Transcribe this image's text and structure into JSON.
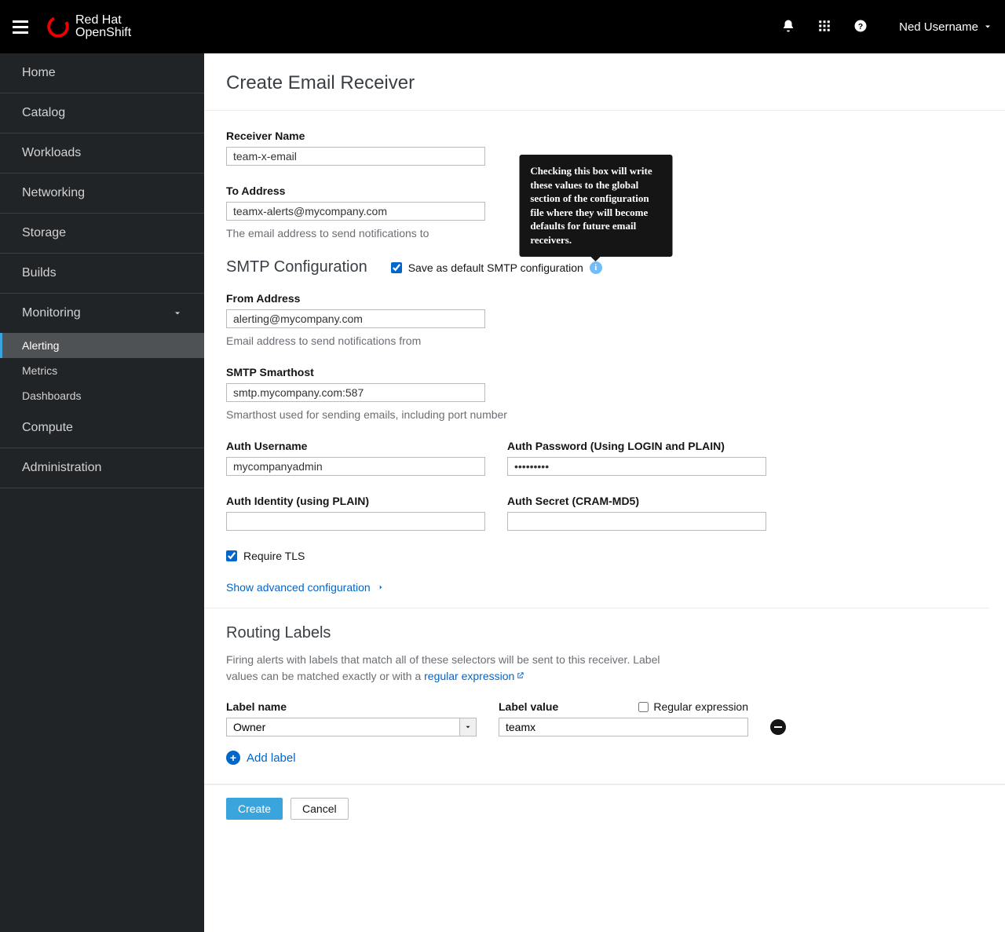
{
  "header": {
    "brand_line1": "Red Hat",
    "brand_line2": "OpenShift",
    "username": "Ned Username"
  },
  "sidebar": {
    "items": [
      {
        "label": "Home"
      },
      {
        "label": "Catalog"
      },
      {
        "label": "Workloads"
      },
      {
        "label": "Networking"
      },
      {
        "label": "Storage"
      },
      {
        "label": "Builds"
      },
      {
        "label": "Monitoring",
        "expanded": true,
        "children": [
          {
            "label": "Alerting",
            "active": true
          },
          {
            "label": "Metrics"
          },
          {
            "label": "Dashboards"
          }
        ]
      },
      {
        "label": "Compute"
      },
      {
        "label": "Administration"
      }
    ]
  },
  "page": {
    "title": "Create Email Receiver",
    "receiver_name_label": "Receiver Name",
    "receiver_name_value": "team-x-email",
    "to_address_label": "To Address",
    "to_address_value": "teamx-alerts@mycompany.com",
    "to_address_help": "The email address to send notifications to",
    "smtp_section_title": "SMTP Configuration",
    "save_default_label": "Save as default SMTP configuration",
    "save_default_checked": true,
    "tooltip_text": "Checking this box will write these values to the global section of the configuration file where they will become defaults for future email receivers.",
    "from_address_label": "From Address",
    "from_address_value": "alerting@mycompany.com",
    "from_address_help": "Email address to send notifications from",
    "smarthost_label": "SMTP Smarthost",
    "smarthost_value": "smtp.mycompany.com:587",
    "smarthost_help": "Smarthost used for sending emails, including port number",
    "auth_user_label": "Auth Username",
    "auth_user_value": "mycompanyadmin",
    "auth_pass_label": "Auth Password (Using LOGIN and PLAIN)",
    "auth_pass_value": "•••••••••",
    "auth_identity_label": "Auth Identity (using PLAIN)",
    "auth_identity_value": "",
    "auth_secret_label": "Auth Secret (CRAM-MD5)",
    "auth_secret_value": "",
    "require_tls_label": "Require TLS",
    "require_tls_checked": true,
    "show_advanced_label": "Show advanced configuration",
    "routing_title": "Routing Labels",
    "routing_desc_1": "Firing alerts with labels that match all of these selectors will be sent to this receiver. Label values can be matched exactly or with a ",
    "routing_desc_link": "regular expression",
    "label_name_label": "Label name",
    "label_name_value": "Owner",
    "label_value_label": "Label value",
    "label_value_value": "teamx",
    "regex_label": "Regular expression",
    "regex_checked": false,
    "add_label_text": "Add label",
    "create_btn": "Create",
    "cancel_btn": "Cancel"
  }
}
